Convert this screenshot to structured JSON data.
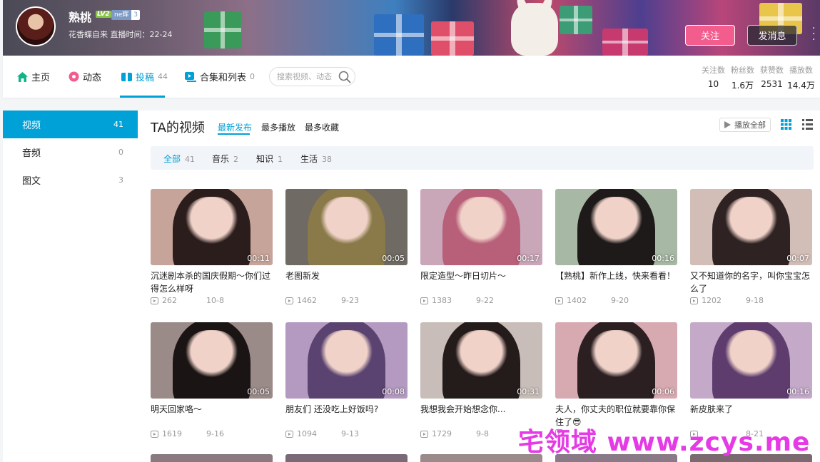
{
  "user": {
    "name": "熟桃",
    "level": "LV2",
    "badge_name": "ne辉",
    "badge_level": "3",
    "sign": "花香蝶自来 直播时间：22-24",
    "follow_label": "关注",
    "message_label": "发消息"
  },
  "nav": {
    "items": [
      {
        "label": "主页",
        "count": ""
      },
      {
        "label": "动态",
        "count": ""
      },
      {
        "label": "投稿",
        "count": "44"
      },
      {
        "label": "合集和列表",
        "count": "0"
      }
    ],
    "search_placeholder": "搜索视频、动态"
  },
  "stats": [
    {
      "label": "关注数",
      "value": "10"
    },
    {
      "label": "粉丝数",
      "value": "1.6万"
    },
    {
      "label": "获赞数",
      "value": "2531"
    },
    {
      "label": "播放数",
      "value": "14.4万"
    }
  ],
  "sidebar": {
    "items": [
      {
        "label": "视频",
        "count": "41"
      },
      {
        "label": "音频",
        "count": "0"
      },
      {
        "label": "图文",
        "count": "3"
      }
    ]
  },
  "main": {
    "title": "TA的视频",
    "sorts": [
      "最新发布",
      "最多播放",
      "最多收藏"
    ],
    "play_all": "播放全部",
    "filters": [
      {
        "label": "全部",
        "count": "41"
      },
      {
        "label": "音乐",
        "count": "2"
      },
      {
        "label": "知识",
        "count": "1"
      },
      {
        "label": "生活",
        "count": "38"
      }
    ]
  },
  "videos": [
    {
      "title": "沉迷剧本杀的国庆假期～你们过得怎么样呀",
      "duration": "00:11",
      "plays": "262",
      "date": "10-8",
      "bg": "#c7a49a",
      "hair": "#2a1d1c"
    },
    {
      "title": "老图新发",
      "duration": "00:05",
      "plays": "1462",
      "date": "9-23",
      "bg": "#6f6a63",
      "hair": "#8a7a4a"
    },
    {
      "title": "限定造型～昨日切片～",
      "duration": "00:17",
      "plays": "1383",
      "date": "9-22",
      "bg": "#c9a7b8",
      "hair": "#b8607a"
    },
    {
      "title": "【熟桃】新作上线，快来看看！",
      "duration": "00:16",
      "plays": "1402",
      "date": "9-20",
      "bg": "#a7b9a4",
      "hair": "#1f1a1a"
    },
    {
      "title": "又不知道你的名字，叫你宝宝怎么了",
      "duration": "00:07",
      "plays": "1202",
      "date": "9-18",
      "bg": "#d3bdb7",
      "hair": "#2e2322"
    },
    {
      "title": "明天回家咯～",
      "duration": "00:05",
      "plays": "1619",
      "date": "9-16",
      "bg": "#9a8a88",
      "hair": "#1a1414"
    },
    {
      "title": "朋友们 还没吃上好饭吗?",
      "duration": "00:08",
      "plays": "1094",
      "date": "9-13",
      "bg": "#b49ac0",
      "hair": "#5a4370"
    },
    {
      "title": "我想我会开始想念你...",
      "duration": "00:31",
      "plays": "1729",
      "date": "9-8",
      "bg": "#c8bdb8",
      "hair": "#241b1b"
    },
    {
      "title": "夫人，你丈夫的职位就要靠你保住了😎",
      "duration": "00:06",
      "plays": "",
      "date": "",
      "bg": "#d7a9b0",
      "hair": "#2b1f22"
    },
    {
      "title": "新皮肤来了",
      "duration": "00:16",
      "plays": "",
      "date": "8-21",
      "bg": "#c4a9c9",
      "hair": "#5e3d6e"
    }
  ],
  "watermark": "宅领域 www.zcys.me",
  "colors": {
    "accent": "#00a1d6",
    "follow": "#f25d8e",
    "watermark": "#e53ae5"
  }
}
